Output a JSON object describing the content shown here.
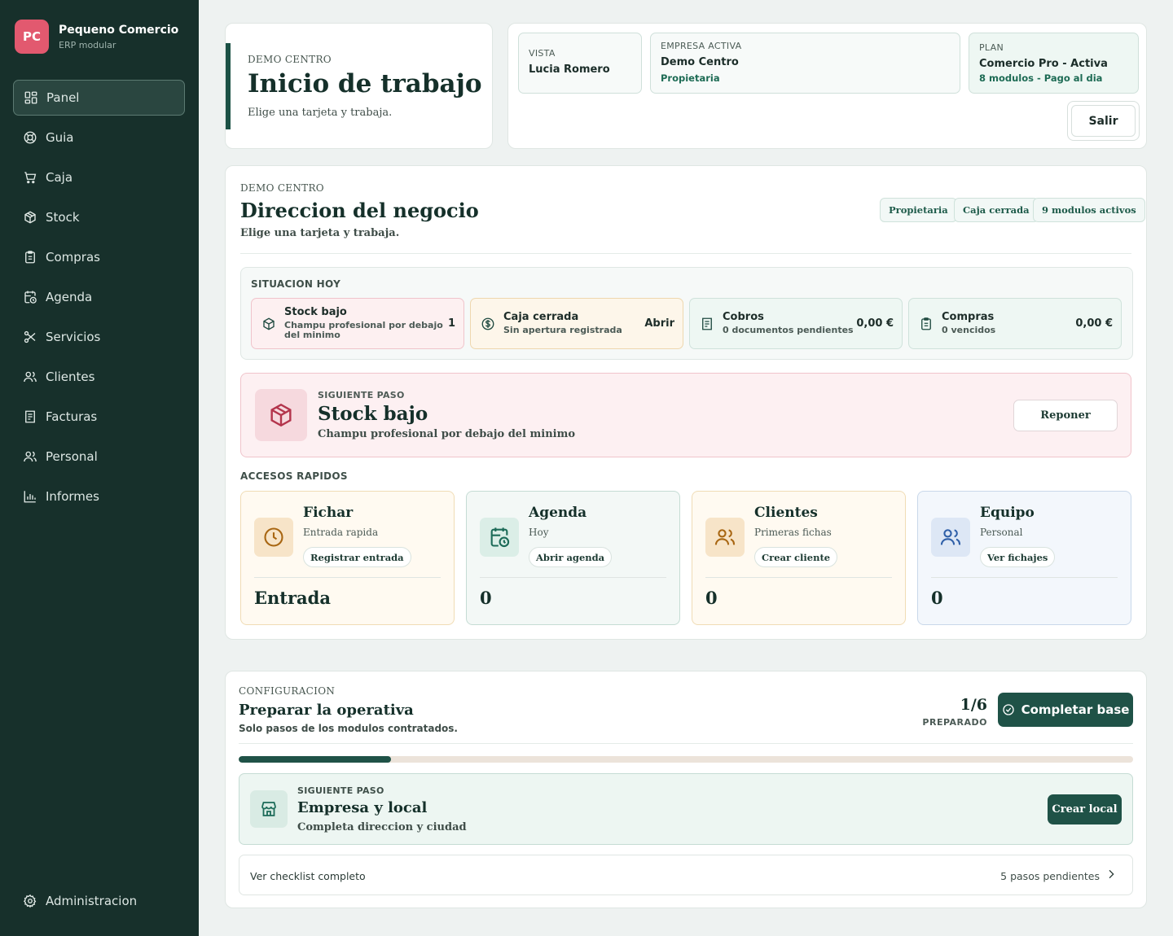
{
  "brand": {
    "initials": "PC",
    "name": "Pequeno Comercio",
    "subtitle": "ERP modular",
    "logo_color": "#e2596f"
  },
  "sidebar": {
    "items": [
      {
        "label": "Panel",
        "icon": "grid-icon",
        "active": true
      },
      {
        "label": "Guia",
        "icon": "lifebuoy-icon"
      },
      {
        "label": "Caja",
        "icon": "cart-icon"
      },
      {
        "label": "Stock",
        "icon": "box-icon"
      },
      {
        "label": "Compras",
        "icon": "clipboard-icon"
      },
      {
        "label": "Agenda",
        "icon": "calendar-clock-icon"
      },
      {
        "label": "Servicios",
        "icon": "scissors-icon"
      },
      {
        "label": "Clientes",
        "icon": "users-icon"
      },
      {
        "label": "Facturas",
        "icon": "receipt-icon"
      },
      {
        "label": "Personal",
        "icon": "users-icon"
      },
      {
        "label": "Informes",
        "icon": "bar-chart-icon"
      }
    ],
    "admin": {
      "label": "Administracion",
      "icon": "gear-icon"
    }
  },
  "header": {
    "eyebrow": "DEMO CENTRO",
    "title": "Inicio de trabajo",
    "subtitle": "Elige una tarjeta y trabaja.",
    "vista": {
      "label": "VISTA",
      "value": "Lucia Romero"
    },
    "empresa": {
      "label": "EMPRESA ACTIVA",
      "value": "Demo Centro",
      "extra": "Propietaria"
    },
    "plan": {
      "label": "PLAN",
      "value": "Comercio Pro - Activa",
      "extra": "8 modulos - Pago al dia"
    },
    "logout_label": "Salir"
  },
  "main": {
    "eyebrow": "DEMO CENTRO",
    "title": "Direccion del negocio",
    "subtitle": "Elige una tarjeta y trabaja.",
    "pills": [
      "Propietaria",
      "Caja cerrada",
      "9 modulos activos"
    ],
    "situacion": {
      "title": "SITUACION HOY",
      "items": [
        {
          "title": "Stock bajo",
          "desc": "Champu profesional por debajo del minimo",
          "value": "1",
          "tone": "red",
          "icon": "box-icon"
        },
        {
          "title": "Caja cerrada",
          "desc": "Sin apertura registrada",
          "value": "Abrir",
          "tone": "amber",
          "icon": "dollar-icon"
        },
        {
          "title": "Cobros",
          "desc": "0 documentos pendientes",
          "value": "0,00 €",
          "tone": "green",
          "icon": "receipt-icon"
        },
        {
          "title": "Compras",
          "desc": "0 vencidos",
          "value": "0,00 €",
          "tone": "green",
          "icon": "clipboard-icon"
        }
      ]
    },
    "next_step": {
      "label": "SIGUIENTE PASO",
      "title": "Stock bajo",
      "desc": "Champu profesional por debajo del minimo",
      "button": "Reponer"
    },
    "accesos": {
      "title": "ACCESOS RAPIDOS",
      "items": [
        {
          "title": "Fichar",
          "subtitle": "Entrada rapida",
          "button": "Registrar entrada",
          "value": "Entrada",
          "tone": "amber",
          "icon": "clock-icon"
        },
        {
          "title": "Agenda",
          "subtitle": "Hoy",
          "button": "Abrir agenda",
          "value": "0",
          "tone": "green",
          "icon": "calendar-clock-icon"
        },
        {
          "title": "Clientes",
          "subtitle": "Primeras fichas",
          "button": "Crear cliente",
          "value": "0",
          "tone": "amber",
          "icon": "users-icon"
        },
        {
          "title": "Equipo",
          "subtitle": "Personal",
          "button": "Ver fichajes",
          "value": "0",
          "tone": "blue",
          "icon": "users-icon"
        }
      ]
    }
  },
  "config": {
    "eyebrow": "CONFIGURACION",
    "title": "Preparar la operativa",
    "subtitle": "Solo pasos de los modulos contratados.",
    "count": "1/6",
    "count_label": "PREPARADO",
    "progress": 0.17,
    "complete_button": "Completar base",
    "next_step": {
      "label": "SIGUIENTE PASO",
      "title": "Empresa y local",
      "desc": "Completa direccion y ciudad",
      "button": "Crear local"
    },
    "checklist": {
      "label": "Ver checklist completo",
      "pending": "5 pasos pendientes"
    }
  },
  "colors": {
    "sidebar": "#17302b",
    "accent": "#1f5247",
    "danger_bg": "#fdf0f2",
    "warning_bg": "#fdf6ea"
  }
}
